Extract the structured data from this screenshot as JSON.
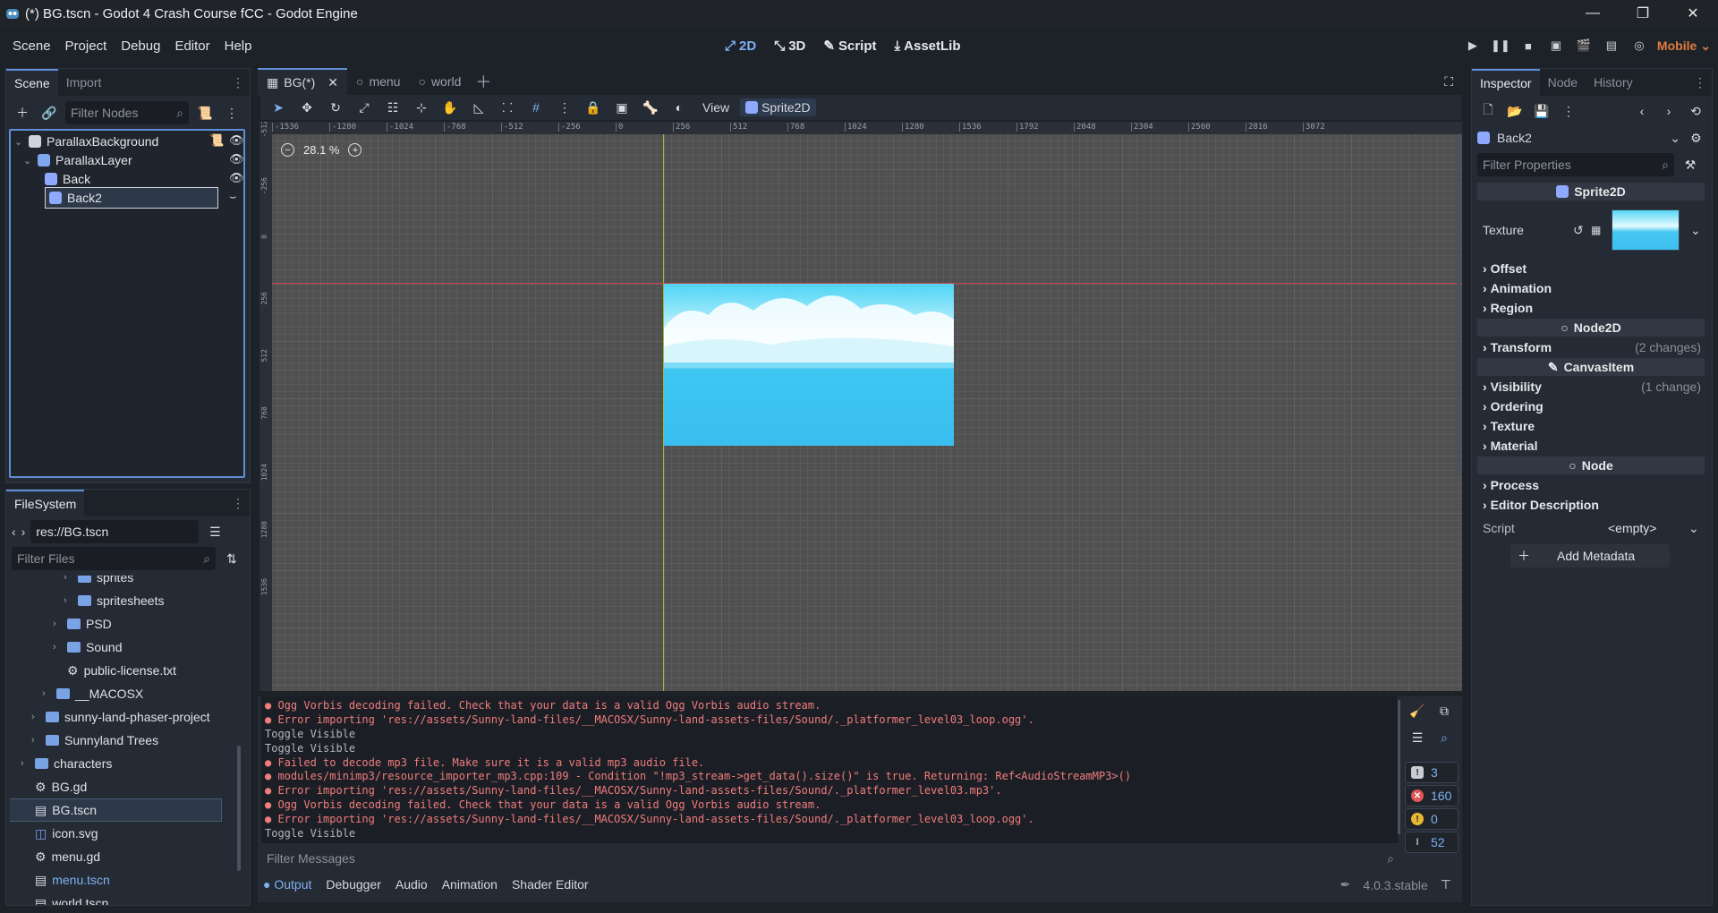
{
  "window": {
    "title": "(*) BG.tscn - Godot 4 Crash Course fCC - Godot Engine"
  },
  "menu": [
    "Scene",
    "Project",
    "Debug",
    "Editor",
    "Help"
  ],
  "workspaces": [
    {
      "label": "2D",
      "active": true
    },
    {
      "label": "3D"
    },
    {
      "label": "Script"
    },
    {
      "label": "AssetLib"
    }
  ],
  "renderer": "Mobile",
  "scene_dock": {
    "tabs": [
      "Scene",
      "Import"
    ],
    "filter_placeholder": "Filter Nodes",
    "nodes": [
      {
        "label": "ParallaxBackground"
      },
      {
        "label": "ParallaxLayer"
      },
      {
        "label": "Back"
      },
      {
        "label": "Back2",
        "selected": true
      }
    ]
  },
  "filesystem": {
    "tab": "FileSystem",
    "path": "res://BG.tscn",
    "filter_placeholder": "Filter Files",
    "items": [
      {
        "label": "sprites",
        "type": "folder",
        "depth": 5
      },
      {
        "label": "spritesheets",
        "type": "folder",
        "depth": 5
      },
      {
        "label": "PSD",
        "type": "folder",
        "depth": 4
      },
      {
        "label": "Sound",
        "type": "folder",
        "depth": 4
      },
      {
        "label": "public-license.txt",
        "type": "gear",
        "depth": 4
      },
      {
        "label": "__MACOSX",
        "type": "folder",
        "depth": 3
      },
      {
        "label": "sunny-land-phaser-project",
        "type": "folder",
        "depth": 2
      },
      {
        "label": "Sunnyland Trees",
        "type": "folder",
        "depth": 2
      },
      {
        "label": "characters",
        "type": "folder",
        "depth": 1
      },
      {
        "label": "BG.gd",
        "type": "gear",
        "depth": 1
      },
      {
        "label": "BG.tscn",
        "type": "scene",
        "depth": 1,
        "selected": true
      },
      {
        "label": "icon.svg",
        "type": "image",
        "depth": 1
      },
      {
        "label": "menu.gd",
        "type": "gear",
        "depth": 1
      },
      {
        "label": "menu.tscn",
        "type": "scene",
        "depth": 1,
        "link": true
      },
      {
        "label": "world.tscn",
        "type": "scene",
        "depth": 1
      }
    ]
  },
  "editor_tabs": [
    {
      "label": "BG(*)",
      "active": true
    },
    {
      "label": "menu"
    },
    {
      "label": "world"
    }
  ],
  "viewport": {
    "view_label": "View",
    "node_chip": "Sprite2D",
    "zoom": "28.1 %",
    "ruler_top": [
      "-1536",
      "-1280",
      "-1024",
      "-768",
      "-512",
      "-256",
      "0",
      "256",
      "512",
      "768",
      "1024",
      "1280",
      "1536",
      "1792",
      "2048",
      "2304",
      "2560",
      "2816",
      "3072"
    ],
    "ruler_left": [
      "-512",
      "-256",
      "0",
      "256",
      "512",
      "768",
      "1024",
      "1280",
      "1536"
    ]
  },
  "output": {
    "lines": [
      {
        "t": "err",
        "text": "Ogg Vorbis decoding failed. Check that your data is a valid Ogg Vorbis audio stream."
      },
      {
        "t": "err",
        "text": "Error importing 'res://assets/Sunny-land-files/__MACOSX/Sunny-land-assets-files/Sound/._platformer_level03_loop.ogg'."
      },
      {
        "t": "plain",
        "text": "Toggle Visible"
      },
      {
        "t": "plain",
        "text": "Toggle Visible"
      },
      {
        "t": "err",
        "text": "Failed to decode mp3 file. Make sure it is a valid mp3 audio file."
      },
      {
        "t": "err",
        "text": "modules/minimp3/resource_importer_mp3.cpp:109 - Condition \"!mp3_stream->get_data().size()\" is true. Returning: Ref<AudioStreamMP3>()"
      },
      {
        "t": "err",
        "text": "Error importing 'res://assets/Sunny-land-files/__MACOSX/Sunny-land-assets-files/Sound/._platformer_level03.mp3'."
      },
      {
        "t": "err",
        "text": "Ogg Vorbis decoding failed. Check that your data is a valid Ogg Vorbis audio stream."
      },
      {
        "t": "err",
        "text": "Error importing 'res://assets/Sunny-land-files/__MACOSX/Sunny-land-assets-files/Sound/._platformer_level03_loop.ogg'."
      },
      {
        "t": "plain",
        "text": "Toggle Visible"
      }
    ],
    "counters": {
      "messages": "3",
      "errors": "160",
      "warnings": "0",
      "editor": "52"
    },
    "filter_placeholder": "Filter Messages",
    "tabs": [
      "Output",
      "Debugger",
      "Audio",
      "Animation",
      "Shader Editor"
    ],
    "version": "4.0.3.stable"
  },
  "inspector": {
    "tabs": [
      "Inspector",
      "Node",
      "History"
    ],
    "object": "Back2",
    "filter_placeholder": "Filter Properties",
    "sections": [
      {
        "head": "Sprite2D"
      },
      {
        "head": "Node2D"
      },
      {
        "head": "CanvasItem"
      },
      {
        "head": "Node"
      }
    ],
    "texture_label": "Texture",
    "props": [
      "Offset",
      "Animation",
      "Region",
      "Transform",
      "Visibility",
      "Ordering",
      "Texture",
      "Material",
      "Process",
      "Editor Description"
    ],
    "transform_changes": "(2 changes)",
    "visibility_changes": "(1 change)",
    "script_label": "Script",
    "script_value": "<empty>",
    "add_metadata": "Add Metadata"
  }
}
